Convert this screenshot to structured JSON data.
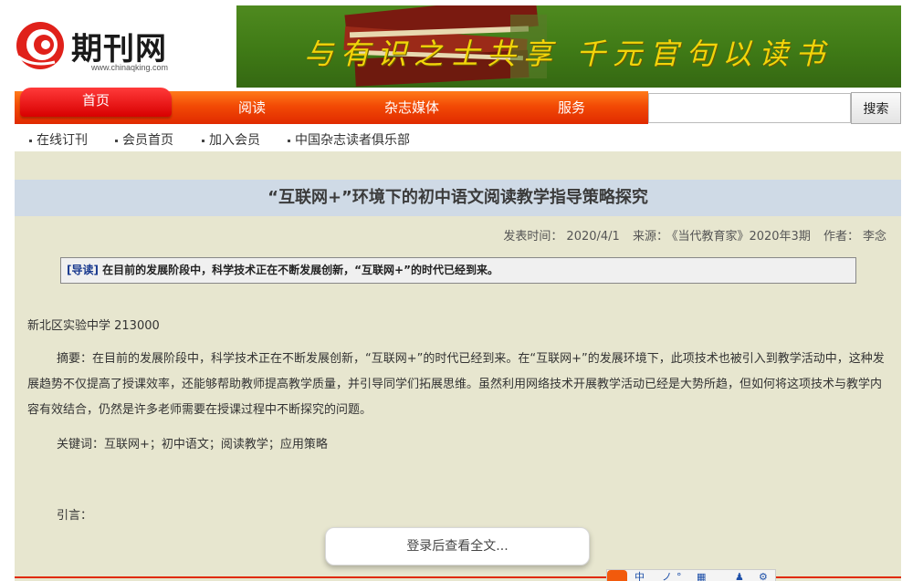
{
  "logo": {
    "name": "期刊网",
    "url": "www.chinaqking.com"
  },
  "banner": {
    "text": "与有识之士共享 千元官句以读书"
  },
  "nav": {
    "items": [
      "首页",
      "阅读",
      "杂志媒体",
      "服务"
    ],
    "search_placeholder": "",
    "search_button": "搜索"
  },
  "subnav": {
    "items": [
      "在线订刊",
      "会员首页",
      "加入会员",
      "中国杂志读者俱乐部"
    ]
  },
  "article": {
    "title": "“互联网+”环境下的初中语文阅读教学指导策略探究",
    "publish_label": "发表时间：",
    "publish_date": "2020/4/1",
    "source_label": "来源：",
    "source": "《当代教育家》2020年3期",
    "author_label": "作者：",
    "author": "李念",
    "lead_tag": "[导读]",
    "lead_text": "在目前的发展阶段中，科学技术正在不断发展创新，“互联网+”的时代已经到来。",
    "school": "新北区实验中学  213000",
    "abstract": "摘要：在目前的发展阶段中，科学技术正在不断发展创新，“互联网+”的时代已经到来。在“互联网+”的发展环境下，此项技术也被引入到教学活动中，这种发展趋势不仅提高了授课效率，还能够帮助教师提高教学质量，并引导同学们拓展思维。虽然利用网络技术开展教学活动已经是大势所趋，但如何将这项技术与教学内容有效结合，仍然是许多老师需要在授课过程中不断探究的问题。",
    "keywords": "关键词：互联网+；初中语文；阅读教学；应用策略",
    "intro": "引言："
  },
  "login_prompt": "登录后查看全文...",
  "ime": {
    "icons": [
      "中",
      "ノ",
      "°",
      "▦",
      "♟",
      "⚙"
    ]
  },
  "colors": {
    "nav_orange": "#f24a05",
    "nav_home_red": "#d80000",
    "content_bg": "#e7e6cf",
    "title_bar_bg": "#cfdae6",
    "banner_green": "#3f7a16",
    "banner_text": "#f2d40a"
  }
}
